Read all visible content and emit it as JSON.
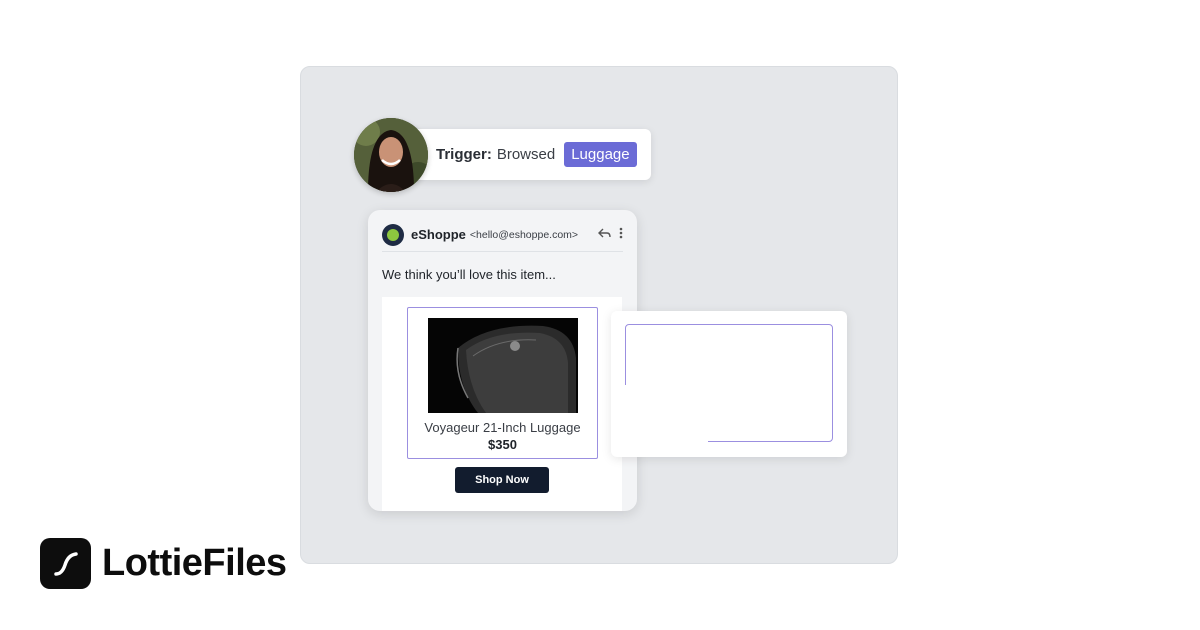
{
  "trigger": {
    "label": "Trigger:",
    "action": "Browsed",
    "tag": "Luggage"
  },
  "email": {
    "sender_name": "eShoppe",
    "sender_email": "<hello@eshoppe.com>",
    "greeting": "We think you’ll love this item...",
    "product": {
      "name": "Voyageur 21-Inch Luggage",
      "price": "$350"
    },
    "cta_label": "Shop Now"
  },
  "brand": {
    "name": "LottieFiles"
  },
  "colors": {
    "accent": "#6b6bd6",
    "button": "#121c2e",
    "panel": "#e5e7ea"
  }
}
